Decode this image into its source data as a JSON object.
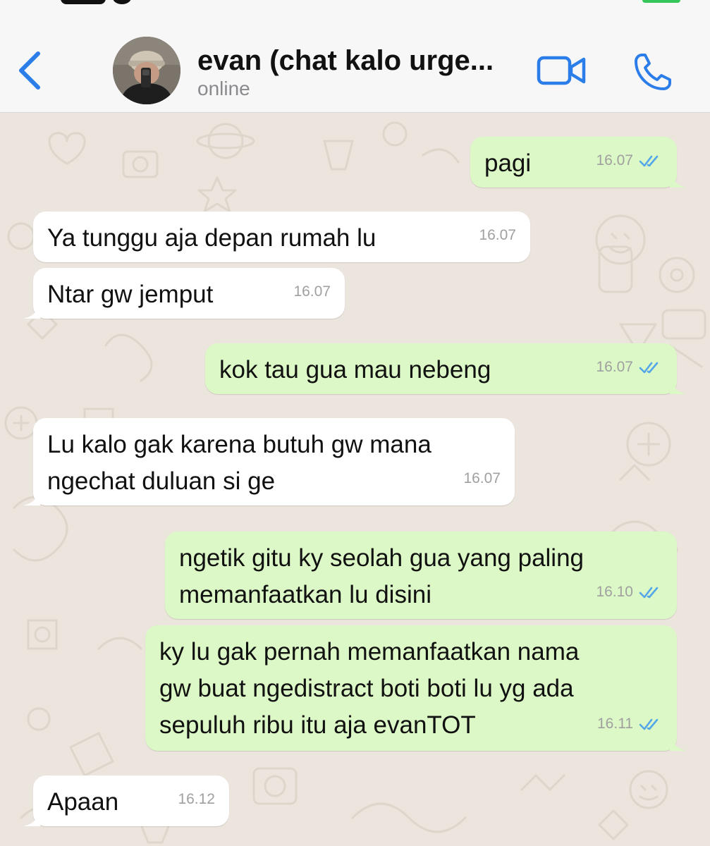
{
  "header": {
    "contact_name": "evan (chat kalo urge...",
    "status": "online"
  },
  "colors": {
    "accent": "#2b7de9",
    "outgoing_bubble": "#dcf8c6",
    "incoming_bubble": "#ffffff",
    "read_ticks": "#53a6e8",
    "background": "#ece5dd"
  },
  "icons": {
    "back": "chevron-left-icon",
    "video": "video-camera-icon",
    "call": "phone-icon",
    "read": "double-check-icon"
  },
  "messages": [
    {
      "direction": "outgoing",
      "text": "pagi",
      "time": "16.07",
      "read": true
    },
    {
      "direction": "incoming",
      "text": "Ya tunggu aja depan rumah lu",
      "time": "16.07"
    },
    {
      "direction": "incoming",
      "text": "Ntar gw jemput",
      "time": "16.07"
    },
    {
      "direction": "outgoing",
      "text": "kok tau gua mau nebeng",
      "time": "16.07",
      "read": true
    },
    {
      "direction": "incoming",
      "text": "Lu kalo gak karena butuh gw mana\nngechat duluan si ge",
      "time": "16.07"
    },
    {
      "direction": "outgoing",
      "text": "ngetik gitu ky seolah gua yang paling\nmemanfaatkan lu disini",
      "time": "16.10",
      "read": true
    },
    {
      "direction": "outgoing",
      "text": "ky lu gak pernah memanfaatkan nama\ngw buat ngedistract boti boti lu yg ada\nsepuluh ribu itu aja evanTOT",
      "time": "16.11",
      "read": true
    },
    {
      "direction": "incoming",
      "text": "Apaan",
      "time": "16.12"
    }
  ]
}
